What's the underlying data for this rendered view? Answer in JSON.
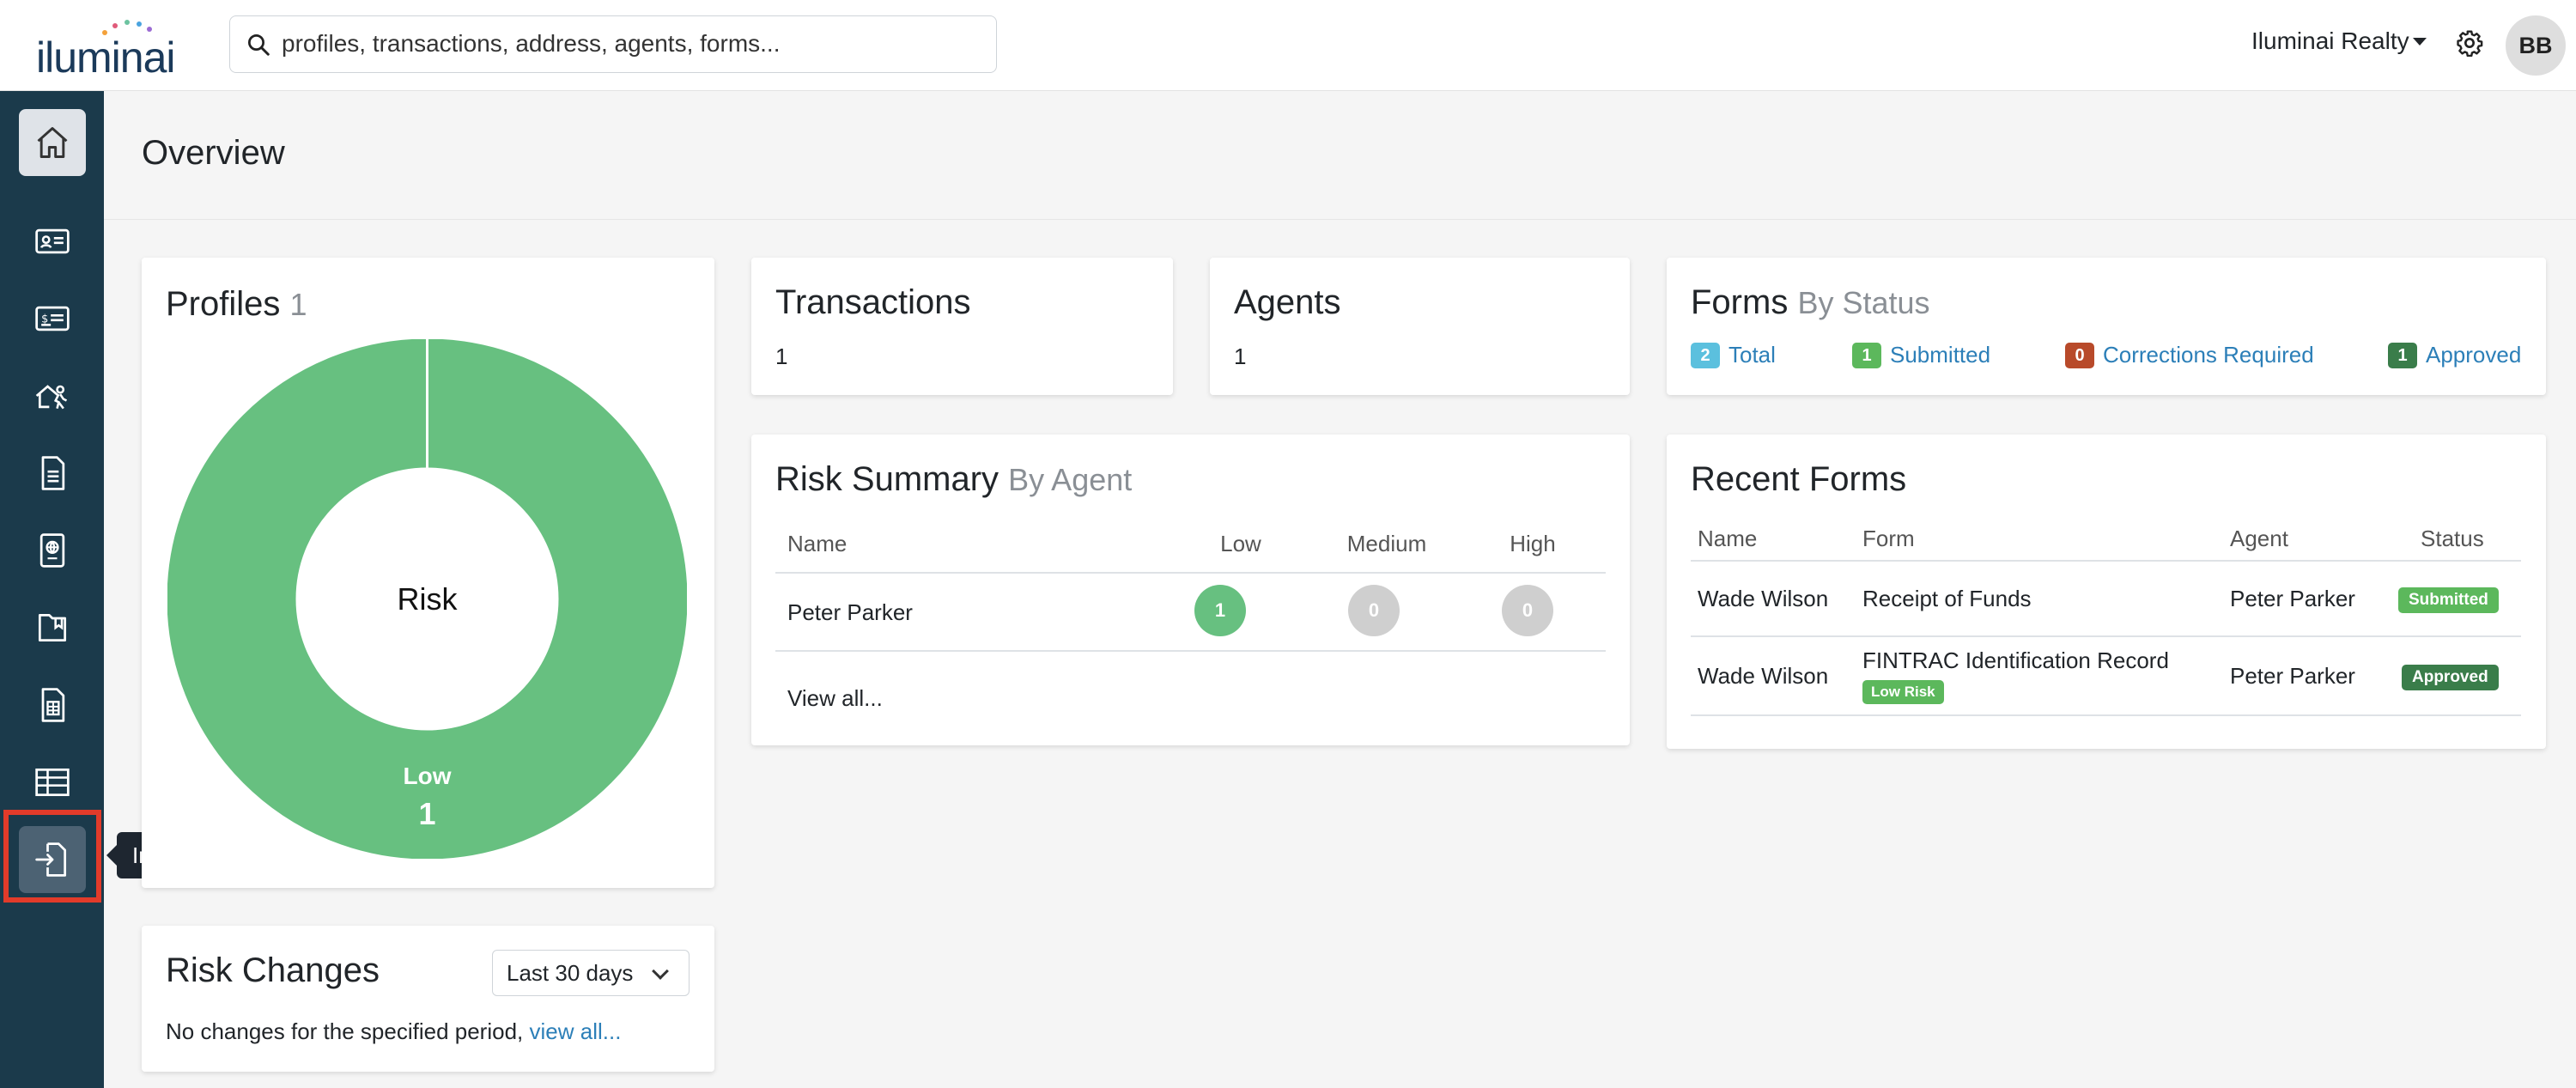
{
  "brand": {
    "name": "iluminai"
  },
  "search": {
    "placeholder": "profiles, transactions, address, agents, forms..."
  },
  "header": {
    "org_name": "Iluminai Realty",
    "avatar_initials": "BB"
  },
  "sidebar": {
    "items": [
      {
        "name": "home",
        "icon": "home-icon"
      },
      {
        "name": "profiles",
        "icon": "id-card-icon"
      },
      {
        "name": "transactions",
        "icon": "payment-card-icon"
      },
      {
        "name": "agents",
        "icon": "agent-house-icon"
      },
      {
        "name": "forms",
        "icon": "document-icon"
      },
      {
        "name": "identification",
        "icon": "passport-icon"
      },
      {
        "name": "guides",
        "icon": "book-icon"
      },
      {
        "name": "reports",
        "icon": "spreadsheet-doc-icon"
      },
      {
        "name": "tables",
        "icon": "table-icon"
      },
      {
        "name": "imports",
        "icon": "import-icon"
      }
    ],
    "tooltip": "Imports"
  },
  "page": {
    "title": "Overview"
  },
  "profiles": {
    "title": "Profiles",
    "count": "1",
    "center_label": "Risk",
    "segment_label": "Low",
    "segment_value": "1",
    "color": "#67c080"
  },
  "risk_changes": {
    "title": "Risk Changes",
    "period": "Last 30 days",
    "message": "No changes for the specified period,",
    "link": "view all..."
  },
  "transactions": {
    "title": "Transactions",
    "value": "1"
  },
  "agents": {
    "title": "Agents",
    "value": "1"
  },
  "forms_status": {
    "title": "Forms",
    "subtitle": "By Status",
    "items": [
      {
        "count": "2",
        "label": "Total",
        "color": "#5bc0de"
      },
      {
        "count": "1",
        "label": "Submitted",
        "color": "#5cb85c"
      },
      {
        "count": "0",
        "label": "Corrections Required",
        "color": "#b84a2a"
      },
      {
        "count": "1",
        "label": "Approved",
        "color": "#3a7d4a"
      }
    ]
  },
  "risk_summary": {
    "title": "Risk Summary",
    "subtitle": "By Agent",
    "columns": [
      "Name",
      "Low",
      "Medium",
      "High"
    ],
    "rows": [
      {
        "name": "Peter Parker",
        "low": "1",
        "medium": "0",
        "high": "0"
      }
    ],
    "view_all": "View all..."
  },
  "recent_forms": {
    "title": "Recent Forms",
    "columns": [
      "Name",
      "Form",
      "Agent",
      "Status"
    ],
    "rows": [
      {
        "name": "Wade Wilson",
        "form": "Receipt of Funds",
        "agent": "Peter Parker",
        "status": "Submitted",
        "tag": ""
      },
      {
        "name": "Wade Wilson",
        "form": "FINTRAC Identification Record",
        "agent": "Peter Parker",
        "status": "Approved",
        "tag": "Low Risk"
      }
    ]
  }
}
